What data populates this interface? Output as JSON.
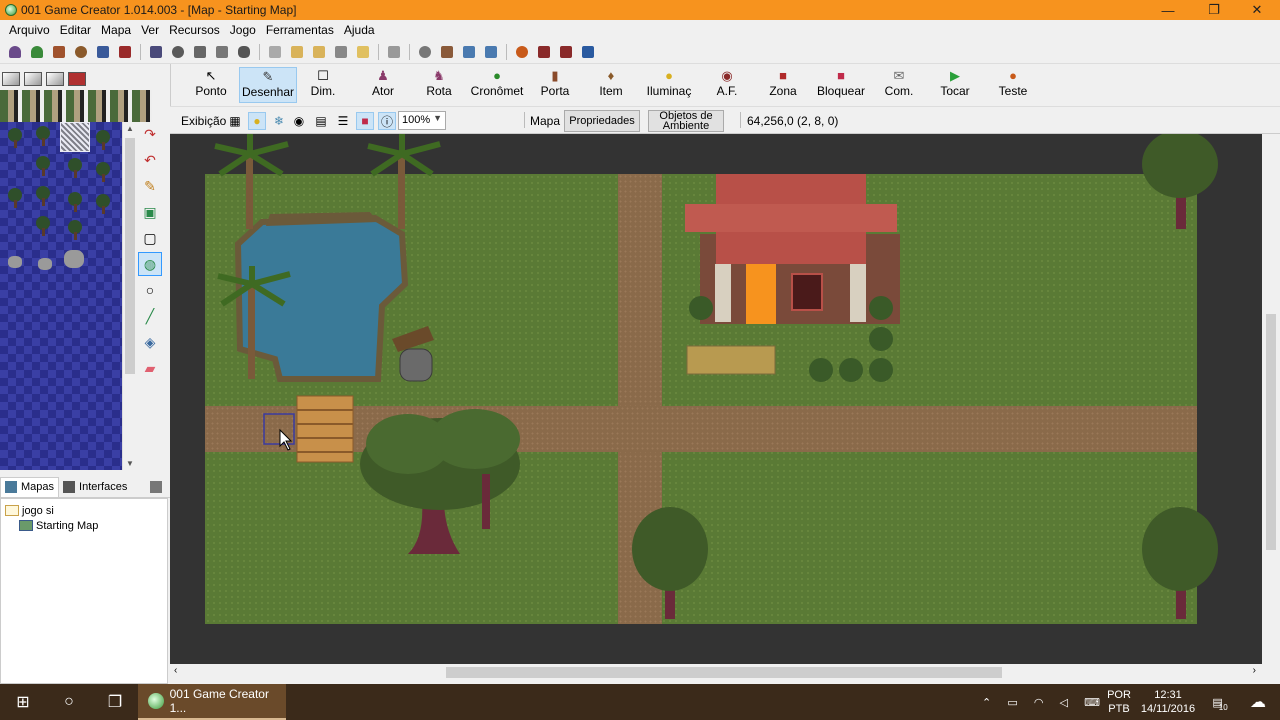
{
  "window": {
    "title": "001 Game Creator 1.014.003 - [Map - Starting Map]",
    "minimize": "—",
    "maximize": "❐",
    "close": "✕"
  },
  "menu": [
    "Arquivo",
    "Editar",
    "Mapa",
    "Ver",
    "Recursos",
    "Jogo",
    "Ferramentas",
    "Ajuda"
  ],
  "map_toolbar": {
    "buttons": [
      "Ponto",
      "Desenhar",
      "Dim.",
      "Ator",
      "Rota",
      "Cronômet",
      "Porta",
      "Item",
      "Iluminaç",
      "A.F.",
      "Zona",
      "Bloquear",
      "Com.",
      "Tocar",
      "Teste"
    ],
    "active": "Desenhar"
  },
  "view_bar": {
    "exibicao": "Exibição",
    "zoom": "100%",
    "mapa": "Mapa",
    "propriedades": "Propriedades",
    "objetos_line1": "Objetos de",
    "objetos_line2": "Ambiente",
    "coords": "64,256,0 (2, 8, 0)"
  },
  "left_tabs": {
    "mapas": "Mapas",
    "interfaces": "Interfaces"
  },
  "project_tree": {
    "root": "jogo si",
    "child": "Starting Map"
  },
  "taskbar": {
    "app": "001 Game Creator 1...",
    "lang1": "POR",
    "lang2": "PTB",
    "time": "12:31",
    "date": "14/11/2016",
    "notif_count": "10"
  }
}
